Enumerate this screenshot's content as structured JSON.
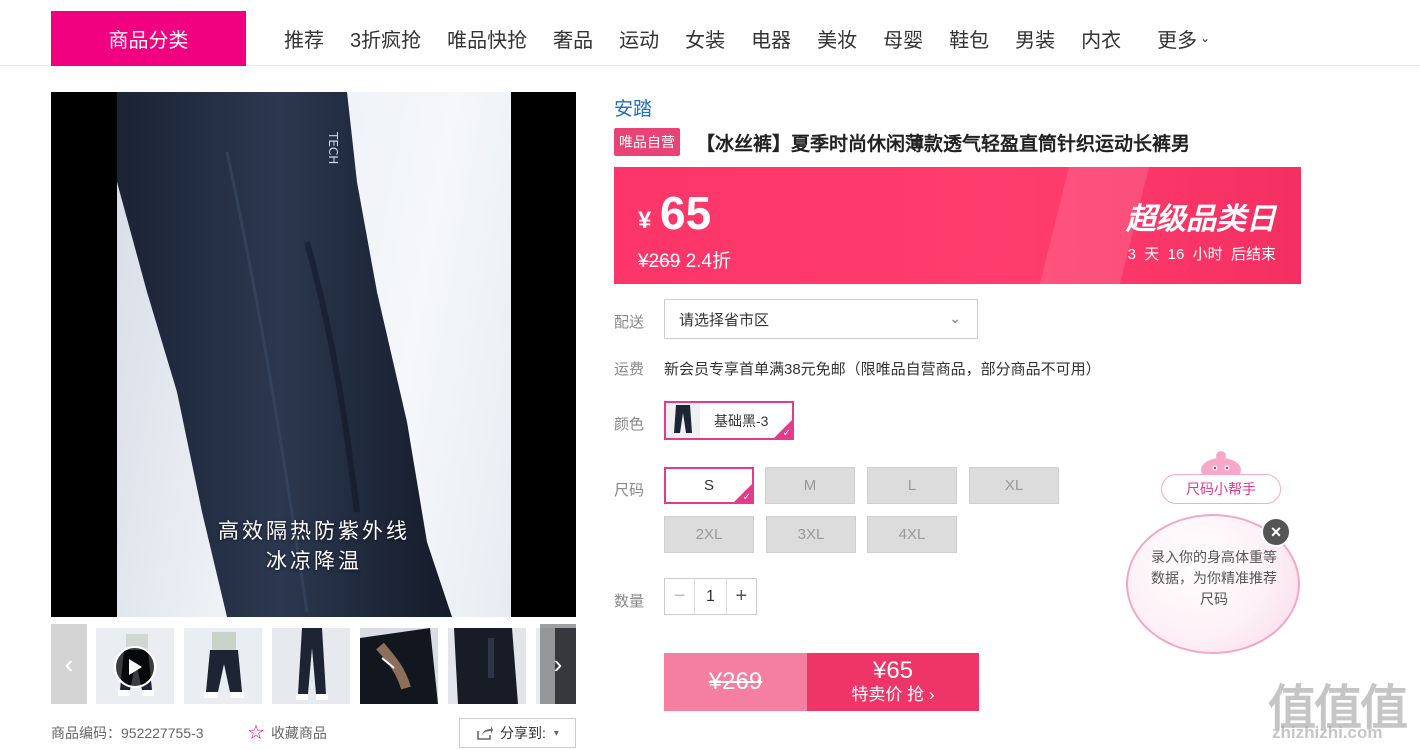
{
  "nav": {
    "category_label": "商品分类",
    "items": [
      "推荐",
      "3折疯抢",
      "唯品快抢",
      "奢品",
      "运动",
      "女装",
      "电器",
      "美妆",
      "母婴",
      "鞋包",
      "男装",
      "内衣"
    ],
    "more_label": "更多"
  },
  "gallery": {
    "overlay_line1": "高效隔热防紫外线",
    "overlay_line2": "冰凉降温",
    "prev_icon": "chevron-left-icon",
    "next_icon": "chevron-right-icon",
    "thumb_count": 6
  },
  "meta": {
    "code_label": "商品编码：",
    "code_value": "952227755-3",
    "favorite_label": "收藏商品",
    "share_label": "分享到:"
  },
  "product": {
    "brand": "安踏",
    "badge": "唯品自营",
    "title": "【冰丝裤】夏季时尚休闲薄款透气轻盈直筒针织运动长裤男"
  },
  "price": {
    "currency": "¥",
    "current": "65",
    "original": "¥269",
    "discount": "2.4折",
    "promo_title": "超级品类日",
    "countdown": "3  天  16  小时  后结束"
  },
  "delivery": {
    "label": "配送",
    "placeholder": "请选择省市区"
  },
  "shipping": {
    "label": "运费",
    "text": "新会员专享首单满38元免邮（限唯品自营商品，部分商品不可用）"
  },
  "color": {
    "label": "颜色",
    "option": "基础黑-3"
  },
  "sizes": {
    "label": "尺码",
    "options": [
      "S",
      "M",
      "L",
      "XL",
      "2XL",
      "3XL",
      "4XL"
    ],
    "selected": "S"
  },
  "quantity": {
    "label": "数量",
    "value": "1",
    "minus": "−",
    "plus": "+"
  },
  "buy": {
    "original": "¥269",
    "price": "¥65",
    "action": "特卖价 抢 ›"
  },
  "size_helper": {
    "title": "尺码小帮手",
    "text": "录入你的身高体重等数据，为你精准推荐尺码"
  },
  "watermark": {
    "main": "值值值",
    "sub": "zhizhizhi.com"
  },
  "colors": {
    "brand_pink": "#f10180",
    "price_red": "#ff3d6d",
    "link_blue": "#1e6fbf"
  }
}
